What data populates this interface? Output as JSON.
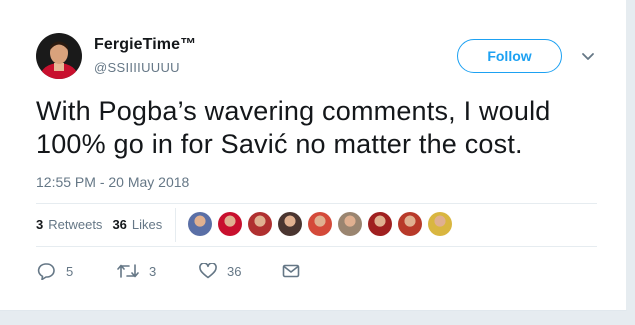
{
  "user": {
    "name": "FergieTime™",
    "handle": "@SSIIIIUUUU"
  },
  "follow_label": "Follow",
  "tweet": {
    "text": "With Pogba’s wavering comments, I would 100% go in for Savić no matter the cost.",
    "timestamp": "12:55 PM - 20 May 2018"
  },
  "stats": {
    "retweets_count": "3",
    "retweets_label": "Retweets",
    "likes_count": "36",
    "likes_label": "Likes"
  },
  "liker_avatars": [
    "#5a6fa6",
    "#c8102e",
    "#b03030",
    "#4a3530",
    "#d44a3a",
    "#9a8570",
    "#a02020",
    "#b83a2a",
    "#d9b640"
  ],
  "actions": {
    "replies": "5",
    "retweets": "3",
    "likes": "36"
  },
  "colors": {
    "accent": "#1da1f2",
    "secondary_text": "#657786",
    "primary_text": "#14171a"
  }
}
